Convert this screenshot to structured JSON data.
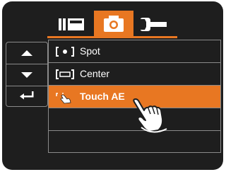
{
  "tabs": [
    {
      "name": "playback",
      "icon": "playback-menu-icon"
    },
    {
      "name": "camera",
      "icon": "camera-icon",
      "selected": true
    },
    {
      "name": "setup",
      "icon": "wrench-icon"
    }
  ],
  "nav": {
    "up_icon": "arrow-up-icon",
    "down_icon": "arrow-down-icon",
    "enter_icon": "return-icon"
  },
  "menu": {
    "items": [
      {
        "label": "Spot",
        "icon": "spot-metering-icon"
      },
      {
        "label": "Center",
        "icon": "center-metering-icon"
      },
      {
        "label": "Touch AE",
        "icon": "touch-ae-icon",
        "selected": true
      },
      {
        "label": ""
      },
      {
        "label": ""
      }
    ]
  },
  "colors": {
    "accent": "#e87722",
    "background": "#1e1e1e",
    "border": "#8a8a8a",
    "text": "#ffffff"
  }
}
